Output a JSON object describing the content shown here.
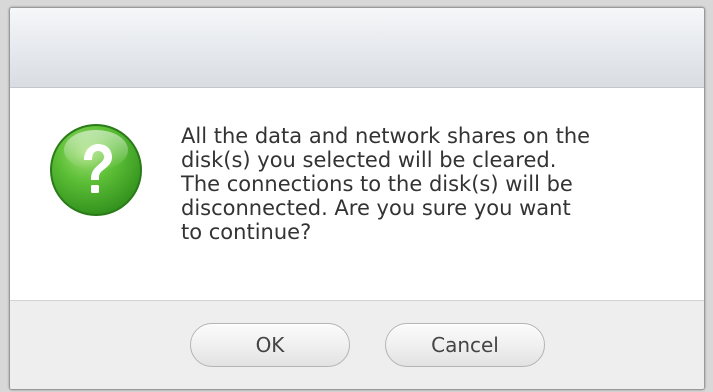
{
  "dialog": {
    "message": "All the data and network shares on the\ndisk(s) you selected will be cleared.\nThe connections to the disk(s) will be\ndisconnected. Are you sure you want\nto continue?",
    "icon": "question-icon",
    "ok_label": "OK",
    "cancel_label": "Cancel"
  },
  "colors": {
    "icon_green": "#4cae2f",
    "text": "#333333",
    "footer_bg": "#eeeeee"
  }
}
